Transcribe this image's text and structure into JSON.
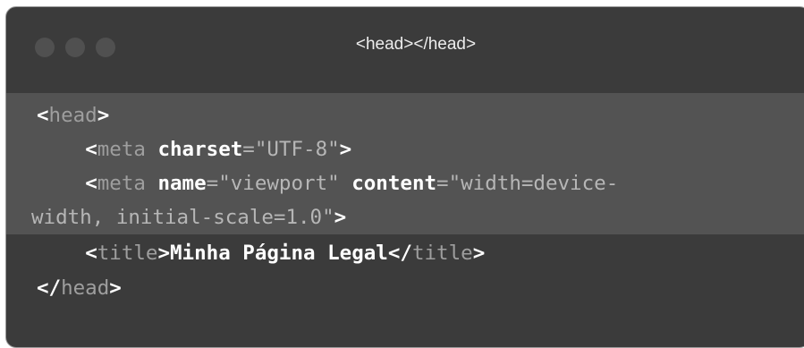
{
  "window": {
    "title": "<head></head>",
    "controls": [
      "close",
      "minimize",
      "zoom"
    ]
  },
  "code": {
    "line1": {
      "open": "<",
      "tag": "head",
      "close": ">"
    },
    "line2": {
      "open": "<",
      "tag": "meta",
      "attr1": "charset",
      "eq1": "=",
      "val1": "\"UTF-8\"",
      "close": ">"
    },
    "line3": {
      "open": "<",
      "tag": "meta",
      "attr1": "name",
      "eq1": "=",
      "val1": "\"viewport\"",
      "attr2": "content",
      "eq2": "=",
      "val2": "\"width=device-"
    },
    "line4": {
      "val": "width, initial-scale=1.0\"",
      "close": ">"
    },
    "line5": {
      "open": "<",
      "tag": "title",
      "close": ">",
      "text": "Minha Página Legal",
      "open2": "</",
      "tag2": "title",
      "close2": ">"
    },
    "line6": {
      "open": "</",
      "tag": "head",
      "close": ">"
    }
  }
}
